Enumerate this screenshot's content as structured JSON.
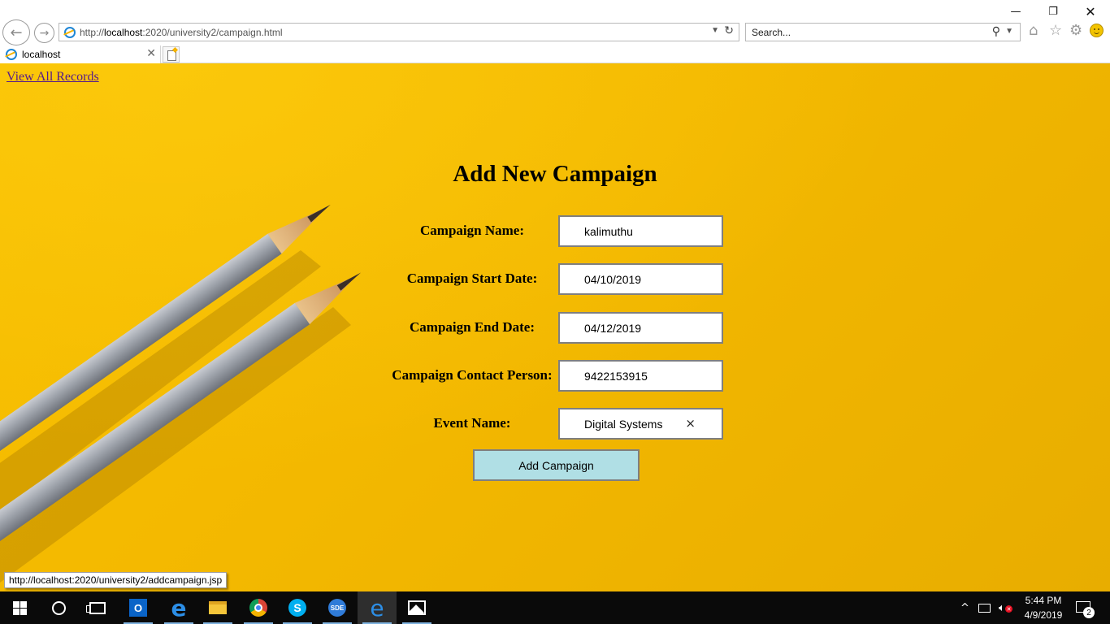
{
  "window": {
    "minimize_glyph": "—",
    "restore_glyph": "❐",
    "close_glyph": "✕"
  },
  "browser": {
    "address_prefix": "http://",
    "address_host": "localhost",
    "address_path": ":2020/university2/campaign.html",
    "search_placeholder": "Search...",
    "tab_title": "localhost",
    "status_url": "http://localhost:2020/university2/addcampaign.jsp"
  },
  "page": {
    "nav_link": "View All Records",
    "title": "Add New Campaign",
    "fields": [
      {
        "label": "Campaign Name:",
        "value": "kalimuthu"
      },
      {
        "label": "Campaign Start Date:",
        "value": "04/10/2019"
      },
      {
        "label": "Campaign End Date:",
        "value": "04/12/2019"
      },
      {
        "label": "Campaign Contact Person:",
        "value": "9422153915"
      },
      {
        "label": "Event Name:",
        "value": "Digital Systems",
        "clear_glyph": "×"
      }
    ],
    "submit_label": "Add Campaign",
    "colors": {
      "background": "#f5b900",
      "button": "#b0dfe5",
      "link": "#551a8b"
    }
  },
  "taskbar": {
    "apps": [
      "start",
      "cortana",
      "task-view",
      "outlook",
      "edge",
      "file-explorer",
      "chrome",
      "skype",
      "sde",
      "internet-explorer",
      "photos"
    ],
    "outlook_letter": "O",
    "skype_letter": "S",
    "sde_label": "SDE",
    "clock_time": "5:44 PM",
    "clock_date": "4/9/2019",
    "notification_count": "2"
  }
}
